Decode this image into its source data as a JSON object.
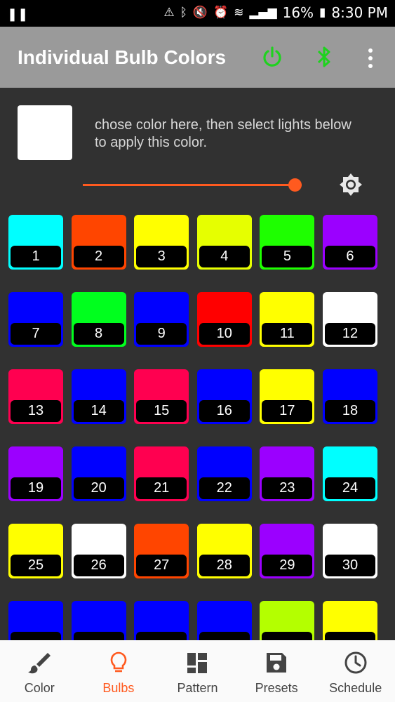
{
  "status_bar": {
    "time": "8:30 PM",
    "battery": "16%"
  },
  "app_bar": {
    "title": "Individual Bulb Colors",
    "power_color": "#1fd21f",
    "bluetooth_color": "#1fd21f"
  },
  "picker": {
    "selected_color": "#ffffff",
    "hint": "chose color here, then select lights below to apply this color.",
    "brightness": 0.97,
    "accent": "#ff5a1f"
  },
  "bulbs": [
    {
      "n": "1",
      "color": "#00ffff"
    },
    {
      "n": "2",
      "color": "#ff4500"
    },
    {
      "n": "3",
      "color": "#ffff00"
    },
    {
      "n": "4",
      "color": "#e6ff00"
    },
    {
      "n": "5",
      "color": "#1eff00"
    },
    {
      "n": "6",
      "color": "#9b00ff"
    },
    {
      "n": "7",
      "color": "#0000ff"
    },
    {
      "n": "8",
      "color": "#00ff1e"
    },
    {
      "n": "9",
      "color": "#0000ff"
    },
    {
      "n": "10",
      "color": "#ff0000"
    },
    {
      "n": "11",
      "color": "#ffff00"
    },
    {
      "n": "12",
      "color": "#ffffff"
    },
    {
      "n": "13",
      "color": "#ff0050"
    },
    {
      "n": "14",
      "color": "#0000ff"
    },
    {
      "n": "15",
      "color": "#ff0050"
    },
    {
      "n": "16",
      "color": "#0000ff"
    },
    {
      "n": "17",
      "color": "#ffff00"
    },
    {
      "n": "18",
      "color": "#0000ff"
    },
    {
      "n": "19",
      "color": "#9b00ff"
    },
    {
      "n": "20",
      "color": "#0000ff"
    },
    {
      "n": "21",
      "color": "#ff0050"
    },
    {
      "n": "22",
      "color": "#0000ff"
    },
    {
      "n": "23",
      "color": "#9b00ff"
    },
    {
      "n": "24",
      "color": "#00ffff"
    },
    {
      "n": "25",
      "color": "#ffff00"
    },
    {
      "n": "26",
      "color": "#ffffff"
    },
    {
      "n": "27",
      "color": "#ff4500"
    },
    {
      "n": "28",
      "color": "#ffff00"
    },
    {
      "n": "29",
      "color": "#9b00ff"
    },
    {
      "n": "30",
      "color": "#ffffff"
    },
    {
      "n": "",
      "color": "#0000ff"
    },
    {
      "n": "",
      "color": "#0000ff"
    },
    {
      "n": "",
      "color": "#0000ff"
    },
    {
      "n": "",
      "color": "#0000ff"
    },
    {
      "n": "",
      "color": "#b4ff00"
    },
    {
      "n": "",
      "color": "#ffff00"
    }
  ],
  "bottom_nav": {
    "active_color": "#ff5a1f",
    "items": [
      {
        "label": "Color",
        "icon": "brush-icon"
      },
      {
        "label": "Bulbs",
        "icon": "bulb-icon"
      },
      {
        "label": "Pattern",
        "icon": "pattern-icon"
      },
      {
        "label": "Presets",
        "icon": "save-icon"
      },
      {
        "label": "Schedule",
        "icon": "clock-icon"
      }
    ]
  }
}
